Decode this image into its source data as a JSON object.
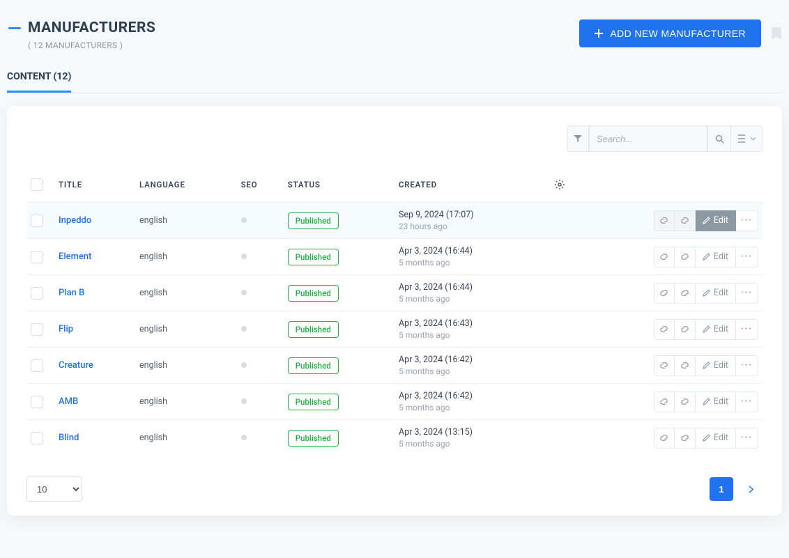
{
  "header": {
    "title": "MANUFACTURERS",
    "subtitle": "( 12 MANUFACTURERS )",
    "add_button": "ADD NEW MANUFACTURER"
  },
  "tabs": [
    {
      "label": "CONTENT (12)"
    }
  ],
  "toolbar": {
    "search_placeholder": "Search..."
  },
  "table": {
    "columns": {
      "title": "TITLE",
      "language": "LANGUAGE",
      "seo": "SEO",
      "status": "STATUS",
      "created": "CREATED"
    },
    "status_label": "Published",
    "edit_label": "Edit",
    "rows": [
      {
        "title": "Inpeddo",
        "language": "english",
        "created": "Sep 9, 2024 (17:07)",
        "ago": "23 hours ago",
        "hovered": true
      },
      {
        "title": "Element",
        "language": "english",
        "created": "Apr 3, 2024 (16:44)",
        "ago": "5 months ago",
        "hovered": false
      },
      {
        "title": "Plan B",
        "language": "english",
        "created": "Apr 3, 2024 (16:44)",
        "ago": "5 months ago",
        "hovered": false
      },
      {
        "title": "Flip",
        "language": "english",
        "created": "Apr 3, 2024 (16:43)",
        "ago": "5 months ago",
        "hovered": false
      },
      {
        "title": "Creature",
        "language": "english",
        "created": "Apr 3, 2024 (16:42)",
        "ago": "5 months ago",
        "hovered": false
      },
      {
        "title": "AMB",
        "language": "english",
        "created": "Apr 3, 2024 (16:42)",
        "ago": "5 months ago",
        "hovered": false
      },
      {
        "title": "Blind",
        "language": "english",
        "created": "Apr 3, 2024 (13:15)",
        "ago": "5 months ago",
        "hovered": false
      }
    ]
  },
  "footer": {
    "page_size": "10",
    "current_page": "1"
  }
}
